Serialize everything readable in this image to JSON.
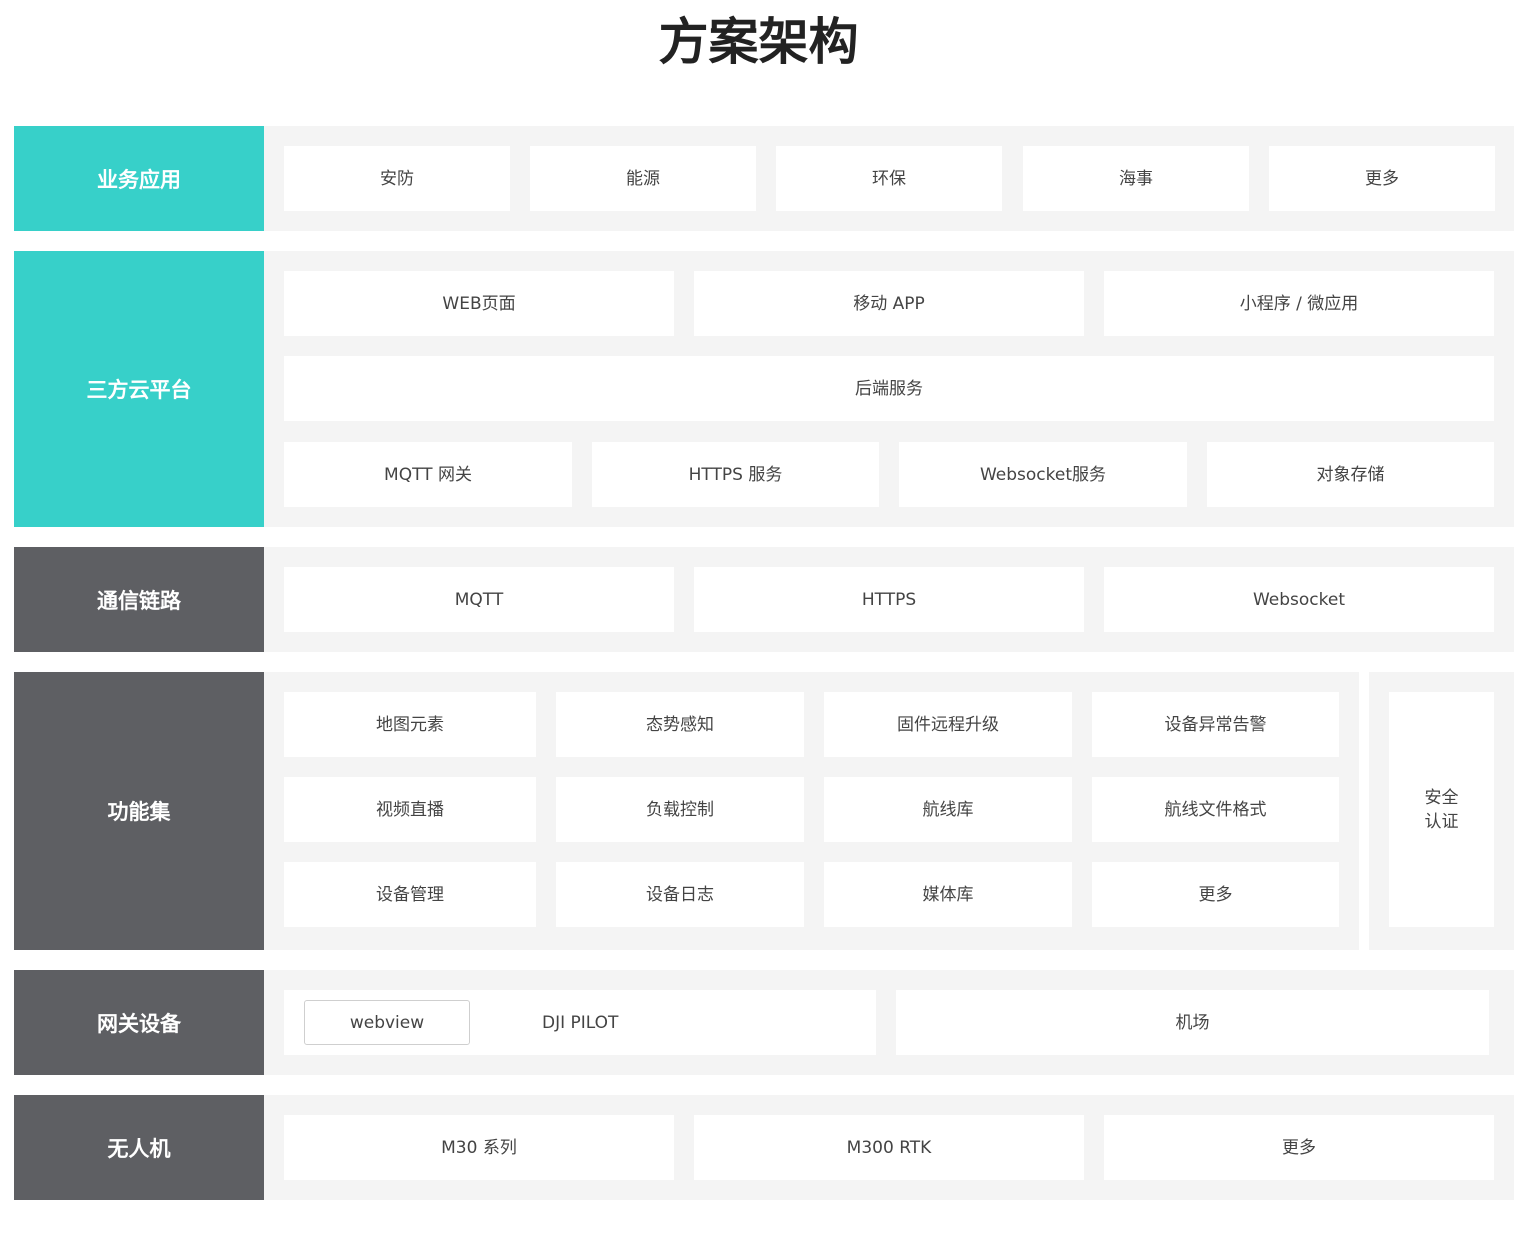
{
  "title": "方案架构",
  "rows": {
    "business": {
      "label": "业务应用",
      "items": [
        "安防",
        "能源",
        "环保",
        "海事",
        "更多"
      ]
    },
    "cloud": {
      "label": "三方云平台",
      "top": [
        "WEB页面",
        "移动 APP",
        "小程序 / 微应用"
      ],
      "middle": "后端服务",
      "bottom": [
        "MQTT 网关",
        "HTTPS 服务",
        "Websocket服务",
        "对象存储"
      ]
    },
    "comm": {
      "label": "通信链路",
      "items": [
        "MQTT",
        "HTTPS",
        "Websocket"
      ]
    },
    "features": {
      "label": "功能集",
      "grid": [
        [
          "地图元素",
          "态势感知",
          "固件远程升级",
          "设备异常告警"
        ],
        [
          "视频直播",
          "负载控制",
          "航线库",
          "航线文件格式"
        ],
        [
          "设备管理",
          "设备日志",
          "媒体库",
          "更多"
        ]
      ],
      "side": [
        "安全",
        "认证"
      ]
    },
    "gateway": {
      "label": "网关设备",
      "webview": "webview",
      "pilot": "DJI PILOT",
      "dock": "机场"
    },
    "drone": {
      "label": "无人机",
      "items": [
        "M30 系列",
        "M300 RTK",
        "更多"
      ]
    }
  },
  "colors": {
    "teal": "#37d0c9",
    "gray": "#5e5f63",
    "panel": "#f4f4f4"
  }
}
